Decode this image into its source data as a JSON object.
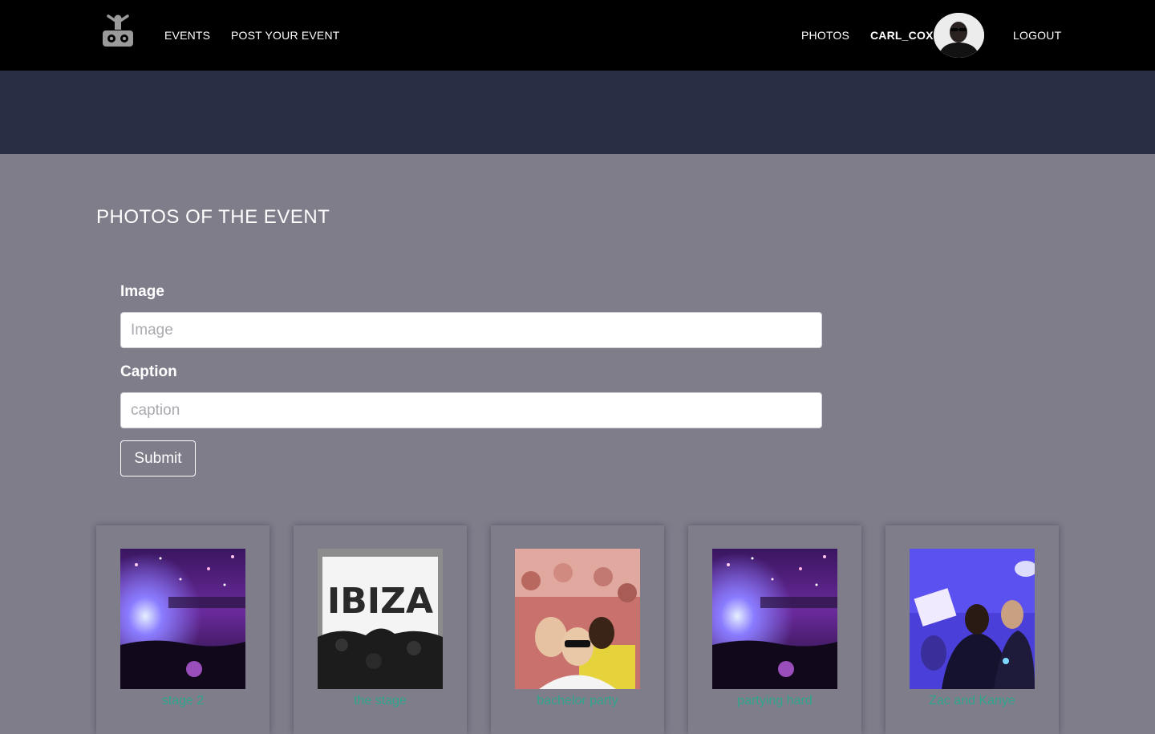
{
  "navbar": {
    "logo_icon": "dj-robot-logo-icon",
    "events_label": "EVENTS",
    "post_event_label": "POST YOUR EVENT",
    "photos_label": "PHOTOS",
    "username": "CARL_COX",
    "logout_label": "LOGOUT"
  },
  "page": {
    "title": "PHOTOS OF THE EVENT"
  },
  "form": {
    "image_label": "Image",
    "image_placeholder": "Image",
    "image_value": "",
    "caption_label": "Caption",
    "caption_placeholder": "caption",
    "caption_value": "",
    "submit_label": "Submit"
  },
  "photos": [
    {
      "caption": "stage 2"
    },
    {
      "caption": "the stage"
    },
    {
      "caption": "bachelor party"
    },
    {
      "caption": "partying hard"
    },
    {
      "caption": "Zac and Kanye"
    }
  ],
  "photo_overlay_text": "IBIZA",
  "colors": {
    "navbar": "#000000",
    "banner": "#282f44",
    "page_bg": "#7f7d8a",
    "caption_link": "#2ea58a"
  }
}
